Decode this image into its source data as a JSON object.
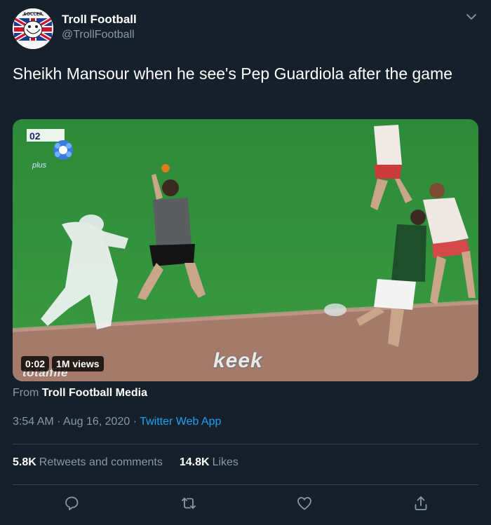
{
  "author": {
    "name": "Troll Football",
    "handle": "@TrollFootball",
    "avatar_icon": "troll-face-union-jack-avatar"
  },
  "tweet": {
    "text": "Sheikh Mansour when he see's Pep Guardiola after the game"
  },
  "media": {
    "duration": "0:02",
    "views": "1M views",
    "overlay_watermark": "totalfiie",
    "keek_watermark": "keek",
    "clock_text": "02",
    "channel_text": "plus"
  },
  "source": {
    "prefix": "From",
    "name": "Troll Football Media"
  },
  "meta": {
    "time": "3:54 AM",
    "separator1": "·",
    "date": "Aug 16, 2020",
    "separator2": "·",
    "app": "Twitter Web App"
  },
  "stats": {
    "retweets_count": "5.8K",
    "retweets_label": "Retweets and comments",
    "likes_count": "14.8K",
    "likes_label": "Likes"
  },
  "colors": {
    "background": "#15202b",
    "accent": "#1da1f2",
    "secondary_text": "#8899a6",
    "divider": "#38444d"
  },
  "icons": {
    "reply": "reply-icon",
    "retweet": "retweet-icon",
    "like": "heart-icon",
    "share": "share-icon",
    "caret": "chevron-down-icon"
  }
}
